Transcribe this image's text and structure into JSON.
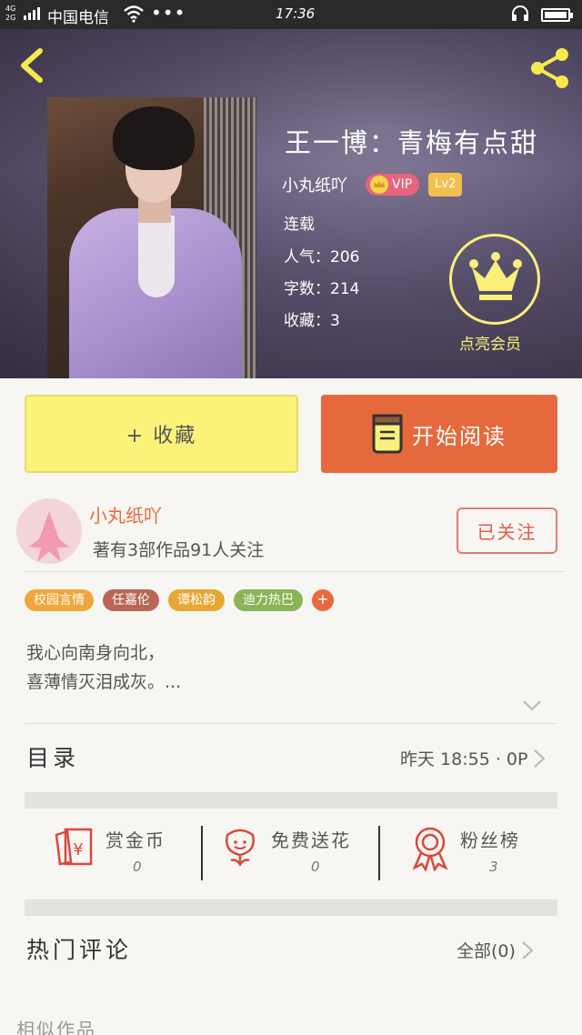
{
  "status_bar": {
    "network": "4G\n2G",
    "carrier": "中国电信",
    "more": "•••",
    "time": "17:36"
  },
  "header": {
    "back_icon": "chevron-left-icon",
    "share_icon": "share-icon"
  },
  "book": {
    "title": "王一博：青梅有点甜",
    "author": "小丸纸吖",
    "vip_label": "VIP",
    "level_label": "Lv2",
    "status": "连载",
    "popularity": "人气：206",
    "word_count": "字数：214",
    "favorites": "收藏：3",
    "vip_cta": "点亮会员"
  },
  "actions": {
    "collect_label": "+ 收藏",
    "read_label": "开始阅读"
  },
  "author_card": {
    "name": "小丸纸吖",
    "stats": "著有3部作品91人关注",
    "follow_label": "已关注"
  },
  "tags": [
    {
      "label": "校园言情",
      "color": "#f0a63a"
    },
    {
      "label": "任嘉伦",
      "color": "#b86655"
    },
    {
      "label": "谭松韵",
      "color": "#e7a734"
    },
    {
      "label": "迪力热巴",
      "color": "#8ab455"
    }
  ],
  "tag_more": "+",
  "synopsis": {
    "line1": "我心向南身向北，",
    "line2": "喜薄情灭泪成灰。..."
  },
  "catalog": {
    "title": "目录",
    "updated": "昨天 18:55 · 0P"
  },
  "stats": [
    {
      "label": "赏金币",
      "value": "0",
      "icon": "red-envelope-icon"
    },
    {
      "label": "免费送花",
      "value": "0",
      "icon": "flower-icon"
    },
    {
      "label": "粉丝榜",
      "value": "3",
      "icon": "award-ribbon-icon"
    }
  ],
  "comments": {
    "title": "热门评论",
    "all_label": "全部(0)"
  },
  "similar_title": "相似作品",
  "colors": {
    "accent_orange": "#e5693c",
    "collect_yellow": "#fbf27a",
    "vip_yellow": "#f9ef7a"
  }
}
